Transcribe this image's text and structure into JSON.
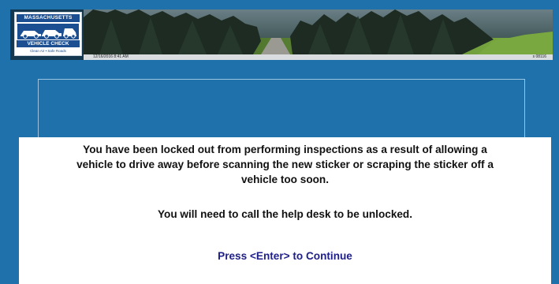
{
  "header": {
    "logo": {
      "state_text": "MASSACHUSETTS",
      "program_text": "VEHICLE CHECK",
      "tagline_text": "Clean Air • Safe Roads"
    },
    "timestamp": "12/16/2016 8:41 AM",
    "station_id": "s 08116"
  },
  "dialog": {
    "message_line1": "You have been locked out from performing inspections as a result of allowing a",
    "message_line2": "vehicle to drive away before scanning the new sticker or scraping the sticker off a",
    "message_line3": "vehicle too soon.",
    "help_message": "You will need to call the help desk to be unlocked.",
    "continue_prompt": "Press <Enter> to Continue"
  },
  "colors": {
    "background": "#1f71ab",
    "dialog_background": "#ffffff",
    "continue_text": "#20208a"
  }
}
